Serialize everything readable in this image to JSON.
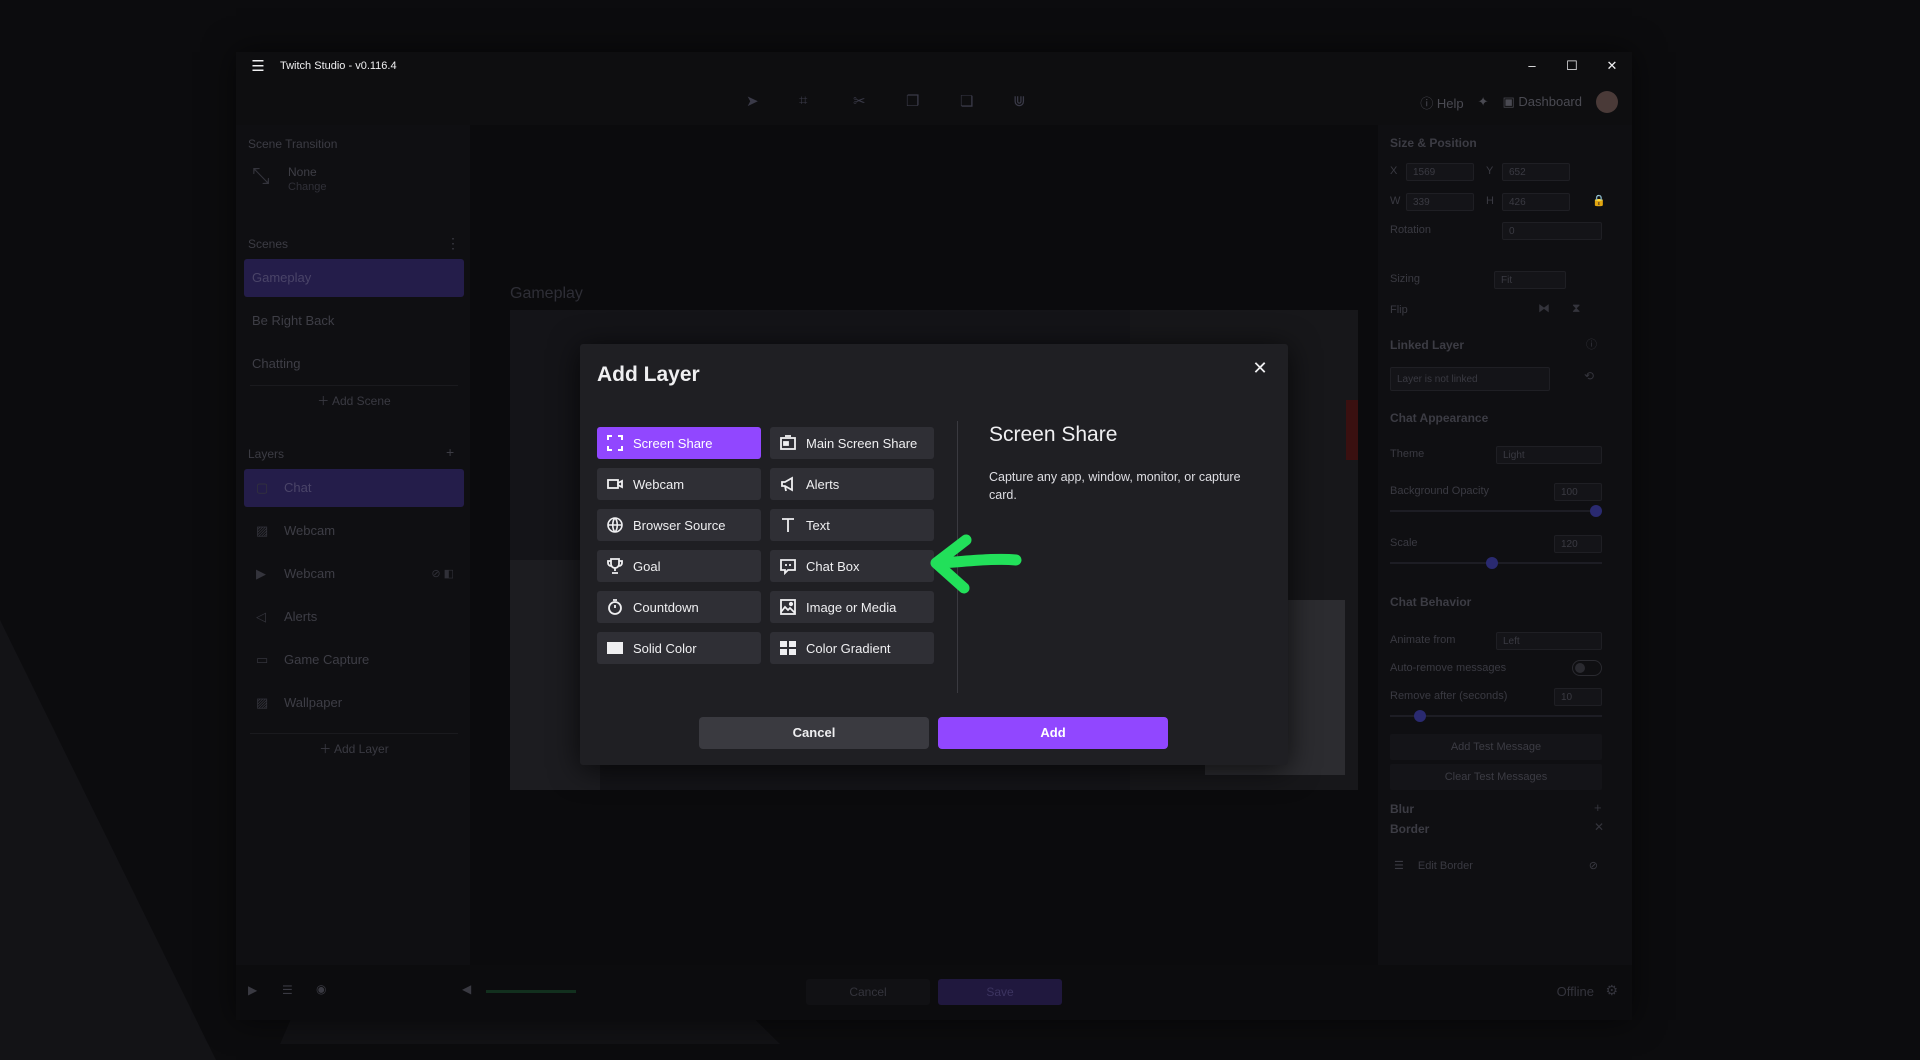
{
  "window": {
    "title": "Twitch Studio - v0.116.4"
  },
  "toolbar": {
    "help_label": "Help",
    "dashboard_label": "Dashboard"
  },
  "left_panel": {
    "scene_transition": {
      "heading": "Scene Transition",
      "name": "None",
      "change_label": "Change"
    },
    "scenes": {
      "heading": "Scenes",
      "items": [
        "Gameplay",
        "Be Right Back",
        "Chatting"
      ],
      "add_label": "Add Scene"
    },
    "layers": {
      "heading": "Layers",
      "items": [
        "Chat",
        "Webcam",
        "Webcam",
        "Alerts",
        "Game Capture",
        "Wallpaper"
      ],
      "add_label": "Add Layer"
    }
  },
  "canvas": {
    "scene_label": "Gameplay"
  },
  "right_panel": {
    "size_position": {
      "heading": "Size & Position",
      "x_label": "X",
      "x": "1569",
      "y_label": "Y",
      "y": "652",
      "w_label": "W",
      "w": "339",
      "h_label": "H",
      "h": "426",
      "rotation_label": "Rotation",
      "rotation": "0"
    },
    "sizing_label": "Sizing",
    "sizing_value": "Fit",
    "flip_label": "Flip",
    "linked_layer": {
      "heading": "Linked Layer",
      "value": "Layer is not linked"
    },
    "chat_appearance": {
      "heading": "Chat Appearance",
      "theme_label": "Theme",
      "theme_value": "Light",
      "bg_opacity_label": "Background Opacity",
      "bg_opacity_value": "100",
      "scale_label": "Scale",
      "scale_value": "120"
    },
    "chat_behavior": {
      "heading": "Chat Behavior",
      "animate_label": "Animate from",
      "animate_value": "Left",
      "auto_remove_label": "Auto-remove messages",
      "remove_after_label": "Remove after (seconds)",
      "remove_after_value": "10"
    },
    "add_test_label": "Add Test Message",
    "clear_test_label": "Clear Test Messages",
    "blur_label": "Blur",
    "border_label": "Border",
    "edit_border_label": "Edit Border"
  },
  "bottom": {
    "cancel_label": "Cancel",
    "save_label": "Save",
    "status": "Offline"
  },
  "modal": {
    "title": "Add Layer",
    "options": [
      {
        "label": "Screen Share",
        "icon": "screen-share-icon",
        "selected": true
      },
      {
        "label": "Main Screen Share",
        "icon": "main-screen-share-icon"
      },
      {
        "label": "Webcam",
        "icon": "webcam-icon"
      },
      {
        "label": "Alerts",
        "icon": "megaphone-icon"
      },
      {
        "label": "Browser Source",
        "icon": "globe-icon"
      },
      {
        "label": "Text",
        "icon": "text-icon"
      },
      {
        "label": "Goal",
        "icon": "trophy-icon"
      },
      {
        "label": "Chat Box",
        "icon": "chat-icon"
      },
      {
        "label": "Countdown",
        "icon": "stopwatch-icon"
      },
      {
        "label": "Image or Media",
        "icon": "image-icon"
      },
      {
        "label": "Solid Color",
        "icon": "solid-square-icon"
      },
      {
        "label": "Color Gradient",
        "icon": "gradient-grid-icon"
      }
    ],
    "description": {
      "title": "Screen Share",
      "text": "Capture any app, window, monitor, or capture card."
    },
    "cancel_label": "Cancel",
    "add_label": "Add"
  },
  "colors": {
    "accent": "#9147ff",
    "annotation_arrow": "#22e05a"
  }
}
